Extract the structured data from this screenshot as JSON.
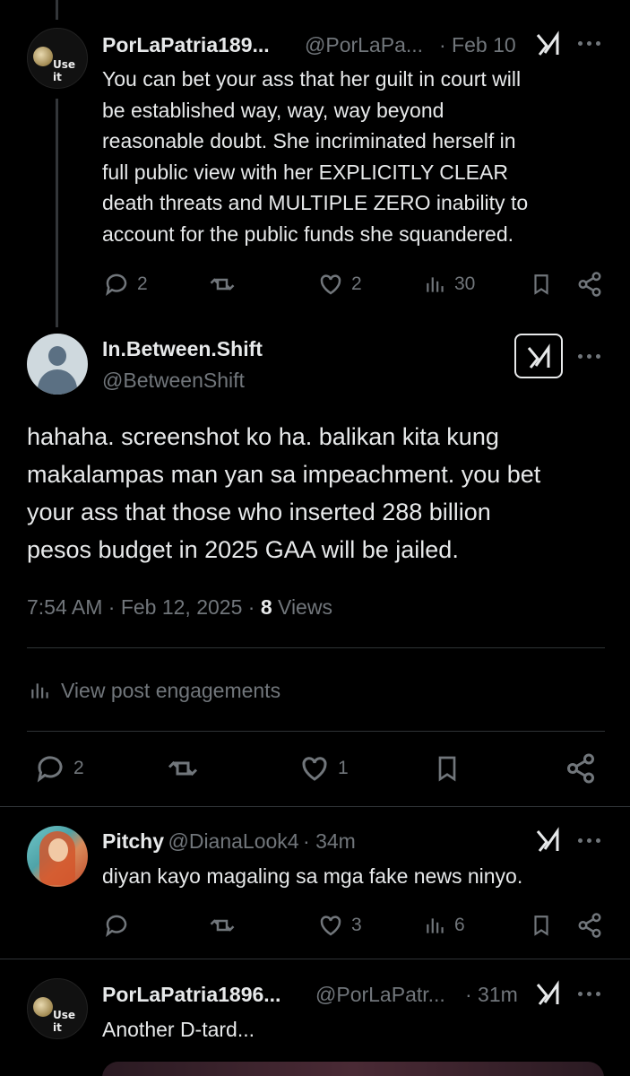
{
  "tweet1": {
    "name": "PorLaPatria189...",
    "handle": "@PorLaPa...",
    "date": "· Feb 10",
    "avatar_text": "Use it",
    "text_lines": [
      "You can bet your ass that her guilt in court will",
      "be established way, way, way beyond",
      "reasonable doubt. She incriminated herself in",
      "full public view with her EXPLICITLY CLEAR",
      "death threats and MULTIPLE ZERO inability to",
      "account for the public funds she squandered."
    ],
    "replies": "2",
    "likes": "2",
    "views": "30"
  },
  "main_tweet": {
    "name": "In.Between.Shift",
    "handle": "@BetweenShift",
    "text_lines": [
      "hahaha. screenshot ko ha. balikan kita kung",
      "makalampas man yan sa impeachment. you bet",
      "your ass that those who inserted 288 billion",
      "pesos budget in 2025 GAA will be jailed."
    ],
    "timestamp": "7:54 AM · Feb 12, 2025 ·",
    "views_count": "8",
    "views_label": "Views",
    "engagements_label": "View post engagements",
    "replies": "2",
    "likes": "1"
  },
  "tweet3": {
    "name": "Pitchy",
    "handle": "@DianaLook4",
    "date": "· 34m",
    "text": "diyan kayo magaling sa mga fake news ninyo.",
    "likes": "3",
    "views": "6"
  },
  "tweet4": {
    "name": "PorLaPatria1896...",
    "handle": "@PorLaPatr...",
    "date": "· 31m",
    "avatar_text": "Use it",
    "text": "Another D-tard..."
  },
  "colors": {
    "background": "#000000",
    "text": "#e7e9ea",
    "muted": "#71767b",
    "divider": "#2f3336"
  },
  "icons": [
    "reply-icon",
    "repost-icon",
    "like-icon",
    "views-icon",
    "bookmark-icon",
    "share-icon",
    "grok-icon",
    "more-icon"
  ]
}
